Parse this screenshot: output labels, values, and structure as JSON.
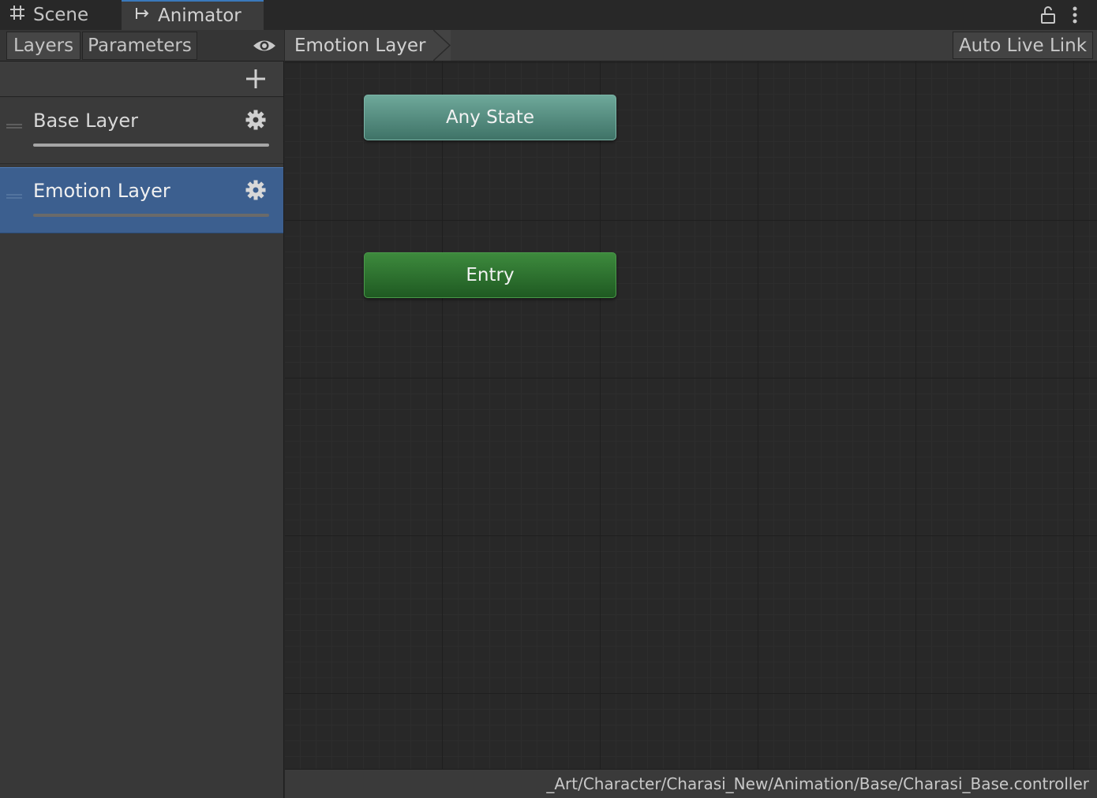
{
  "window_tabs": {
    "scene": {
      "label": "Scene",
      "icon": "hash-icon"
    },
    "animator": {
      "label": "Animator",
      "icon": "animator-graph-icon"
    }
  },
  "window_controls": {
    "lock_icon": "lock-icon",
    "menu_icon": "kebab-menu-icon"
  },
  "left_toolbar": {
    "layers_tab": "Layers",
    "parameters_tab": "Parameters",
    "visibility_icon": "eye-icon"
  },
  "layers_panel": {
    "add_icon": "plus-icon",
    "layers": [
      {
        "name": "Base Layer",
        "selected": false,
        "weight": 1.0
      },
      {
        "name": "Emotion Layer",
        "selected": true,
        "weight": 0.0
      }
    ]
  },
  "breadcrumb": {
    "current": "Emotion Layer"
  },
  "toolbar": {
    "auto_live_link": "Auto Live Link"
  },
  "graph": {
    "nodes": {
      "any_state": {
        "label": "Any State",
        "color": "#5a8f82"
      },
      "entry": {
        "label": "Entry",
        "color": "#2f7130"
      }
    }
  },
  "status_bar": {
    "path": "_Art/Character/Charasi_New/Animation/Base/Charasi_Base.controller"
  },
  "colors": {
    "accent": "#3a79bb",
    "selected_layer": "#3c5f8f"
  }
}
